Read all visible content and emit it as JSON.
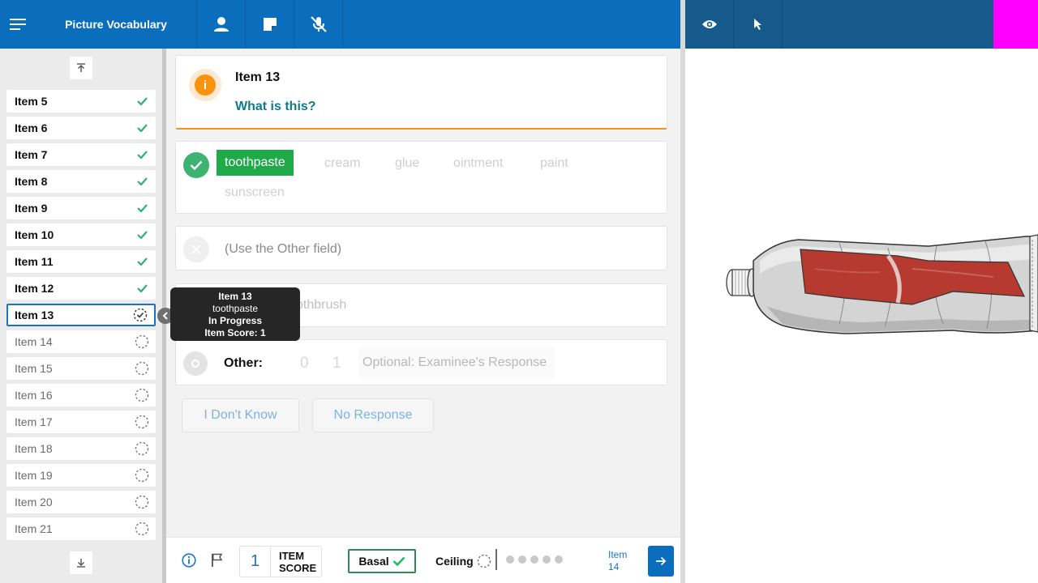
{
  "header": {
    "title": "Picture Vocabulary",
    "icons": [
      "menu-icon",
      "person-icon",
      "note-icon",
      "mic-off-icon"
    ],
    "right_icons": [
      "eye-icon",
      "pointer-icon"
    ],
    "accent": "#0a6ebd"
  },
  "sidebar": {
    "items": [
      {
        "label": "Item 5",
        "status": "complete"
      },
      {
        "label": "Item 6",
        "status": "complete"
      },
      {
        "label": "Item 7",
        "status": "complete"
      },
      {
        "label": "Item 8",
        "status": "complete"
      },
      {
        "label": "Item 9",
        "status": "complete"
      },
      {
        "label": "Item 10",
        "status": "complete"
      },
      {
        "label": "Item 11",
        "status": "complete"
      },
      {
        "label": "Item 12",
        "status": "complete"
      },
      {
        "label": "Item 13",
        "status": "in-progress"
      },
      {
        "label": "Item 14",
        "status": "not-started"
      },
      {
        "label": "Item 15",
        "status": "not-started"
      },
      {
        "label": "Item 16",
        "status": "not-started"
      },
      {
        "label": "Item 17",
        "status": "not-started"
      },
      {
        "label": "Item 18",
        "status": "not-started"
      },
      {
        "label": "Item 19",
        "status": "not-started"
      },
      {
        "label": "Item 20",
        "status": "not-started"
      },
      {
        "label": "Item 21",
        "status": "not-started"
      }
    ]
  },
  "tooltip": {
    "item": "Item 13",
    "answer": "toothpaste",
    "status": "In Progress",
    "score": "Item Score: 1"
  },
  "question": {
    "item": "Item 13",
    "prompt": "What is this?"
  },
  "correct_options": [
    "toothpaste",
    "cream",
    "glue",
    "ointment",
    "paint",
    "sunscreen"
  ],
  "incorrect_option": "(Use the Other field)",
  "dont_know_option": "othbrush",
  "other": {
    "label": "Other:",
    "score0": "0",
    "score1": "1",
    "placeholder": "Optional: Examinee's Response"
  },
  "buttons": {
    "dont_know": "I Don't Know",
    "no_response": "No Response"
  },
  "footer": {
    "item_score_value": "1",
    "item_score_label_1": "ITEM",
    "item_score_label_2": "SCORE",
    "basal": "Basal",
    "ceiling": "Ceiling",
    "next_label_1": "Item",
    "next_label_2": "14"
  }
}
